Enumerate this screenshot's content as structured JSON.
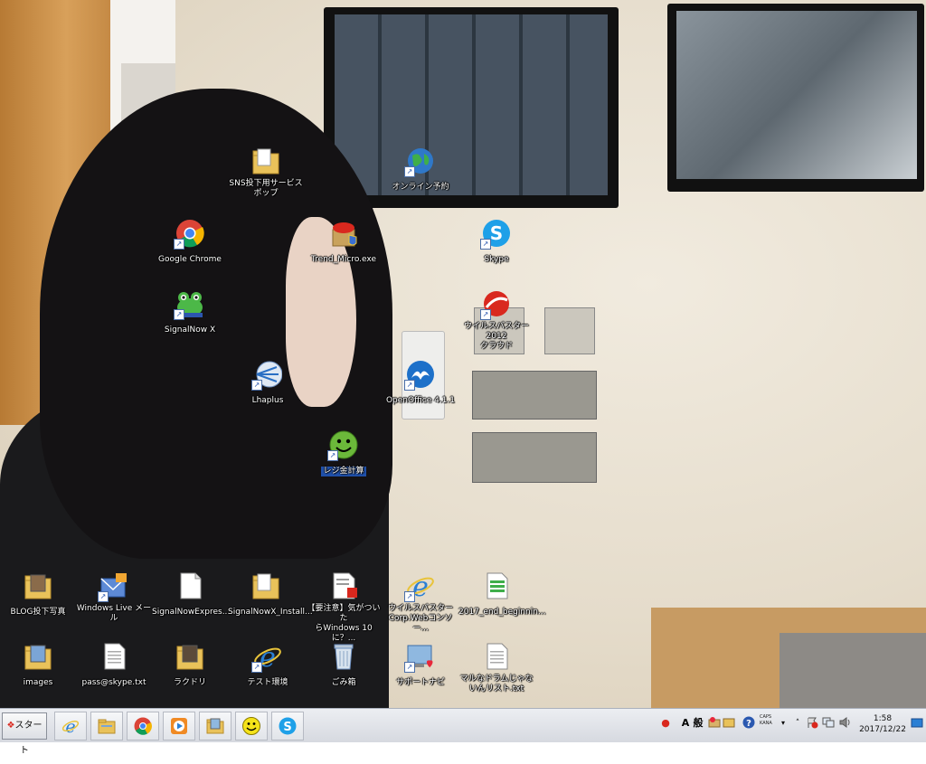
{
  "desktop": {
    "icons": [
      {
        "label": "SNS投下用サービス\nポップ",
        "icon": "folder-icon",
        "selected": false
      },
      {
        "label": "オンライン予約",
        "icon": "globe-icon",
        "selected": false
      },
      {
        "label": "Google Chrome",
        "icon": "chrome-icon",
        "selected": false
      },
      {
        "label": "Trend_Micro.exe",
        "icon": "trend-micro-icon",
        "selected": false
      },
      {
        "label": "Skype",
        "icon": "skype-icon",
        "selected": false
      },
      {
        "label": "SignalNow X",
        "icon": "frog-icon",
        "selected": false
      },
      {
        "label": "ウイルスバスター2012\nクラウド",
        "icon": "virusbuster-icon",
        "selected": false
      },
      {
        "label": "Lhaplus",
        "icon": "lhaplus-icon",
        "selected": false
      },
      {
        "label": "OpenOffice 4.1.1",
        "icon": "openoffice-icon",
        "selected": false
      },
      {
        "label": "レジ金計算",
        "icon": "smiley-icon",
        "selected": true
      },
      {
        "label": "BLOG投下写真",
        "icon": "folder-icon",
        "selected": false
      },
      {
        "label": "Windows Live メール",
        "icon": "windows-live-mail-icon",
        "selected": false
      },
      {
        "label": "SignalNowExpres...",
        "icon": "document-icon",
        "selected": false
      },
      {
        "label": "SignalNowX_Install...",
        "icon": "folder-icon",
        "selected": false
      },
      {
        "label": "【要注意】気がついた\nらWindows 10に？...",
        "icon": "pdf-icon",
        "selected": false
      },
      {
        "label": "ウイルスバスター\nCorp.Webコンソー...",
        "icon": "ie-icon",
        "selected": false
      },
      {
        "label": "2017_end_beginnin...",
        "icon": "spreadsheet-icon",
        "selected": false
      },
      {
        "label": "images",
        "icon": "folder-icon",
        "selected": false
      },
      {
        "label": "pass@skype.txt",
        "icon": "text-file-icon",
        "selected": false
      },
      {
        "label": "ラクドリ",
        "icon": "folder-icon",
        "selected": false
      },
      {
        "label": "テスト環境",
        "icon": "ie-icon",
        "selected": false
      },
      {
        "label": "ごみ箱",
        "icon": "recycle-bin-icon",
        "selected": false
      },
      {
        "label": "サポートナビ",
        "icon": "support-navi-icon",
        "selected": false
      },
      {
        "label": "マルなドラムじゃな\nいんリスト.txt",
        "icon": "text-file-icon",
        "selected": false
      }
    ]
  },
  "taskbar": {
    "start_label": "スタート",
    "pinned": [
      {
        "name": "ie-icon"
      },
      {
        "name": "explorer-icon"
      },
      {
        "name": "chrome-icon"
      },
      {
        "name": "media-player-icon"
      },
      {
        "name": "folder-icon"
      },
      {
        "name": "smiley-icon"
      },
      {
        "name": "skype-icon"
      }
    ],
    "ime": {
      "mode": "A",
      "dict": "般"
    },
    "caps": "CAPS",
    "kana": "KANA",
    "clock_time": "1:58",
    "clock_date": "2017/12/22"
  },
  "colors": {
    "selected_label_bg": "#1f4fa8",
    "taskbar_bg": "#e1e4e9"
  }
}
